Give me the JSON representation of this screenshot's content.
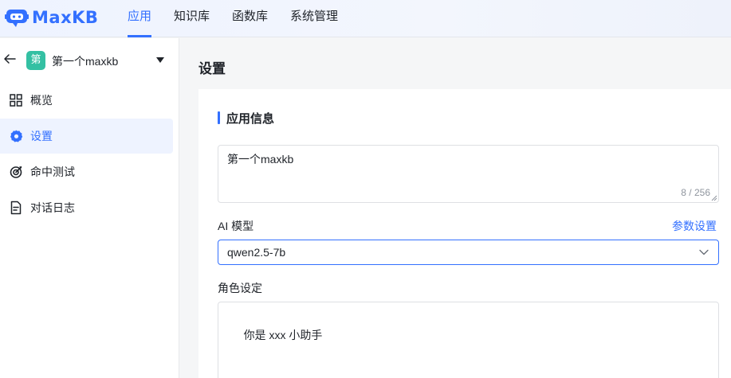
{
  "brand": {
    "name": "MaxKB",
    "accent": "#3370ff"
  },
  "nav": {
    "items": [
      {
        "label": "应用",
        "active": true
      },
      {
        "label": "知识库",
        "active": false
      },
      {
        "label": "函数库",
        "active": false
      },
      {
        "label": "系统管理",
        "active": false
      }
    ]
  },
  "sidebar": {
    "app_avatar": "第",
    "app_name": "第一个maxkb",
    "items": [
      {
        "label": "概览",
        "icon": "grid-icon",
        "active": false
      },
      {
        "label": "设置",
        "icon": "gear-icon",
        "active": true
      },
      {
        "label": "命中测试",
        "icon": "target-icon",
        "active": false
      },
      {
        "label": "对话日志",
        "icon": "document-icon",
        "active": false
      }
    ]
  },
  "main": {
    "page_title": "设置",
    "section_title": "应用信息",
    "name_value": "第一个maxkb",
    "name_counter": "8 / 256",
    "model_label": "AI 模型",
    "param_link": "参数设置",
    "model_value": "qwen2.5-7b",
    "role_label": "角色设定",
    "role_value": "你是 xxx 小助手"
  }
}
